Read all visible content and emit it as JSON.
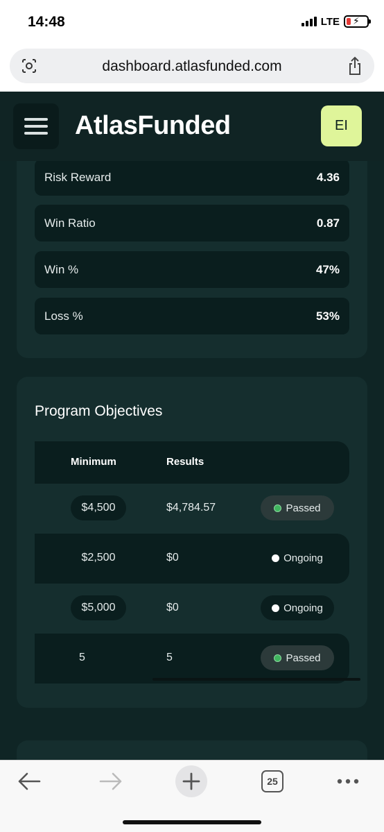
{
  "status_bar": {
    "time": "14:48",
    "network": "LTE"
  },
  "browser": {
    "url": "dashboard.atlasfunded.com",
    "tab_count": "25"
  },
  "header": {
    "brand": "AtlasFunded",
    "avatar_initials": "EI"
  },
  "stats": [
    {
      "label": "Risk Reward",
      "value": "4.36"
    },
    {
      "label": "Win Ratio",
      "value": "0.87"
    },
    {
      "label": "Win %",
      "value": "47%"
    },
    {
      "label": "Loss %",
      "value": "53%"
    }
  ],
  "objectives": {
    "title": "Program Objectives",
    "columns": {
      "minimum": "Minimum",
      "results": "Results"
    },
    "rows": [
      {
        "minimum": "$4,500",
        "result": "$4,784.57",
        "status": "Passed"
      },
      {
        "minimum": "$2,500",
        "result": "$0",
        "status": "Ongoing"
      },
      {
        "minimum": "$5,000",
        "result": "$0",
        "status": "Ongoing"
      },
      {
        "minimum": "5",
        "result": "5",
        "status": "Passed"
      }
    ]
  },
  "colors": {
    "brand_accent": "#dff59a",
    "passed": "#3fb55e",
    "background": "#0f2525",
    "card": "#152e2e"
  }
}
